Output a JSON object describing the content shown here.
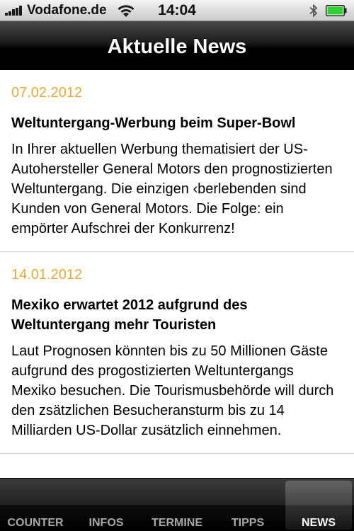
{
  "status_bar": {
    "carrier": "Vodafone.de",
    "time": "14:04"
  },
  "nav": {
    "title": "Aktuelle News"
  },
  "news": [
    {
      "date": "07.02.2012",
      "title": "Weltuntergang-Werbung beim Super-Bowl",
      "body": "In Ihrer aktuellen Werbung thematisiert der US-Autohersteller General Motors den prognostizierten Weltuntergang. Die einzigen ‹berlebenden sind Kunden von General Motors. Die Folge: ein empörter Aufschrei der Konkurrenz!"
    },
    {
      "date": "14.01.2012",
      "title": "Mexiko erwartet 2012 aufgrund des Weltuntergang mehr Touristen",
      "body": "Laut Prognosen könnten bis zu 50 Millionen Gäste aufgrund des progostizierten Weltuntergangs Mexiko besuchen. Die Tourismusbehörde will durch den zsätzlichen Besucheransturm bis zu 14 Milliarden US-Dollar zusätzlich einnehmen."
    }
  ],
  "tabs": [
    {
      "label": "COUNTER",
      "active": false
    },
    {
      "label": "INFOS",
      "active": false
    },
    {
      "label": "TERMINE",
      "active": false
    },
    {
      "label": "TIPPS",
      "active": false
    },
    {
      "label": "NEWS",
      "active": true
    }
  ],
  "colors": {
    "date": "#e5a93b",
    "battery_fill": "#2fd02f"
  },
  "icons": [
    "signal-icon",
    "wifi-icon",
    "bluetooth-icon",
    "battery-icon"
  ]
}
